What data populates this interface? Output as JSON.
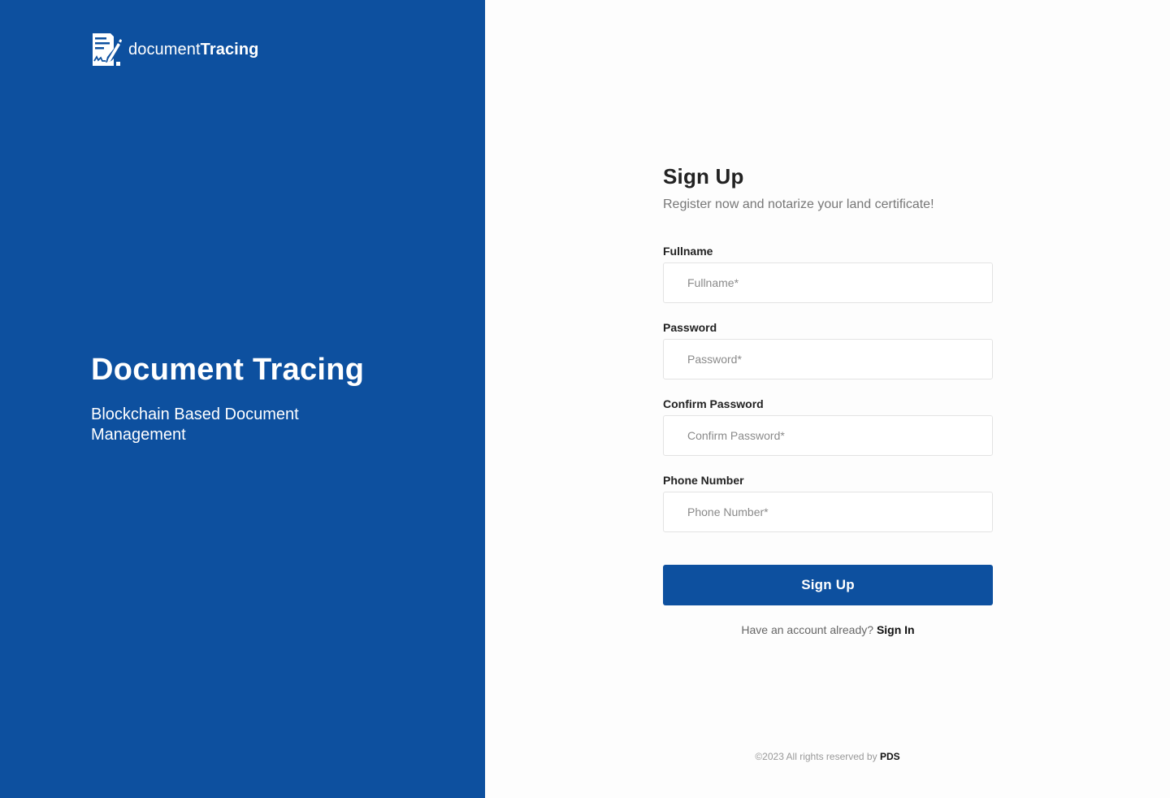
{
  "brand": {
    "name_light": "document",
    "name_bold": "Tracing",
    "logo_icon": "document-signature-icon"
  },
  "hero": {
    "title": "Document Tracing",
    "subtitle": "Blockchain Based Document Management"
  },
  "form": {
    "title": "Sign Up",
    "subtitle": "Register now and notarize your land certificate!",
    "fields": [
      {
        "label": "Fullname",
        "placeholder": "Fullname*",
        "value": ""
      },
      {
        "label": "Password",
        "placeholder": "Password*",
        "value": ""
      },
      {
        "label": "Confirm Password",
        "placeholder": "Confirm Password*",
        "value": ""
      },
      {
        "label": "Phone Number",
        "placeholder": "Phone Number*",
        "value": ""
      }
    ],
    "submit_label": "Sign Up",
    "signin_prompt": "Have an account already?",
    "signin_link": "Sign In"
  },
  "footer": {
    "text": "©2023 All rights reserved by",
    "brand": "PDS"
  },
  "colors": {
    "primary": "#0d509f",
    "panel_text": "#ffffff",
    "heading": "#222222",
    "muted": "#777777"
  }
}
